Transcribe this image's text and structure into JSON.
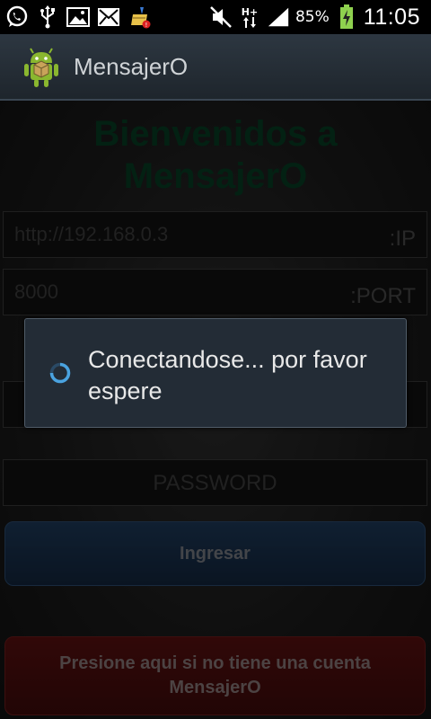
{
  "status_bar": {
    "battery_percent": "85%",
    "time": "11:05",
    "network_type": "H+",
    "icons": [
      "whatsapp-icon",
      "usb-icon",
      "image-icon",
      "mail-icon",
      "cleaner-icon",
      "mute-icon",
      "network-arrows-icon",
      "signal-icon",
      "battery-charging-icon"
    ]
  },
  "action_bar": {
    "title": "MensajerO"
  },
  "main": {
    "welcome_line1": "Bienvenidos a",
    "welcome_line2": "MensajerO",
    "ip_field": {
      "value": "http://192.168.0.3",
      "suffix": ":IP"
    },
    "port_field": {
      "value": "8000",
      "suffix": ":PORT"
    },
    "username_field": {
      "value": ""
    },
    "password_field": {
      "placeholder": "PASSWORD"
    },
    "login_button": "Ingresar",
    "register_button": "Presione aqui si no tiene una cuenta MensajerO"
  },
  "dialog": {
    "message": "Conectandose... por favor espere"
  },
  "colors": {
    "welcome_text": "#063d23",
    "login_button": "#1e3a5a",
    "register_button": "#5a1010",
    "dialog_bg": "#232c36",
    "spinner": "#4aa3e0"
  }
}
